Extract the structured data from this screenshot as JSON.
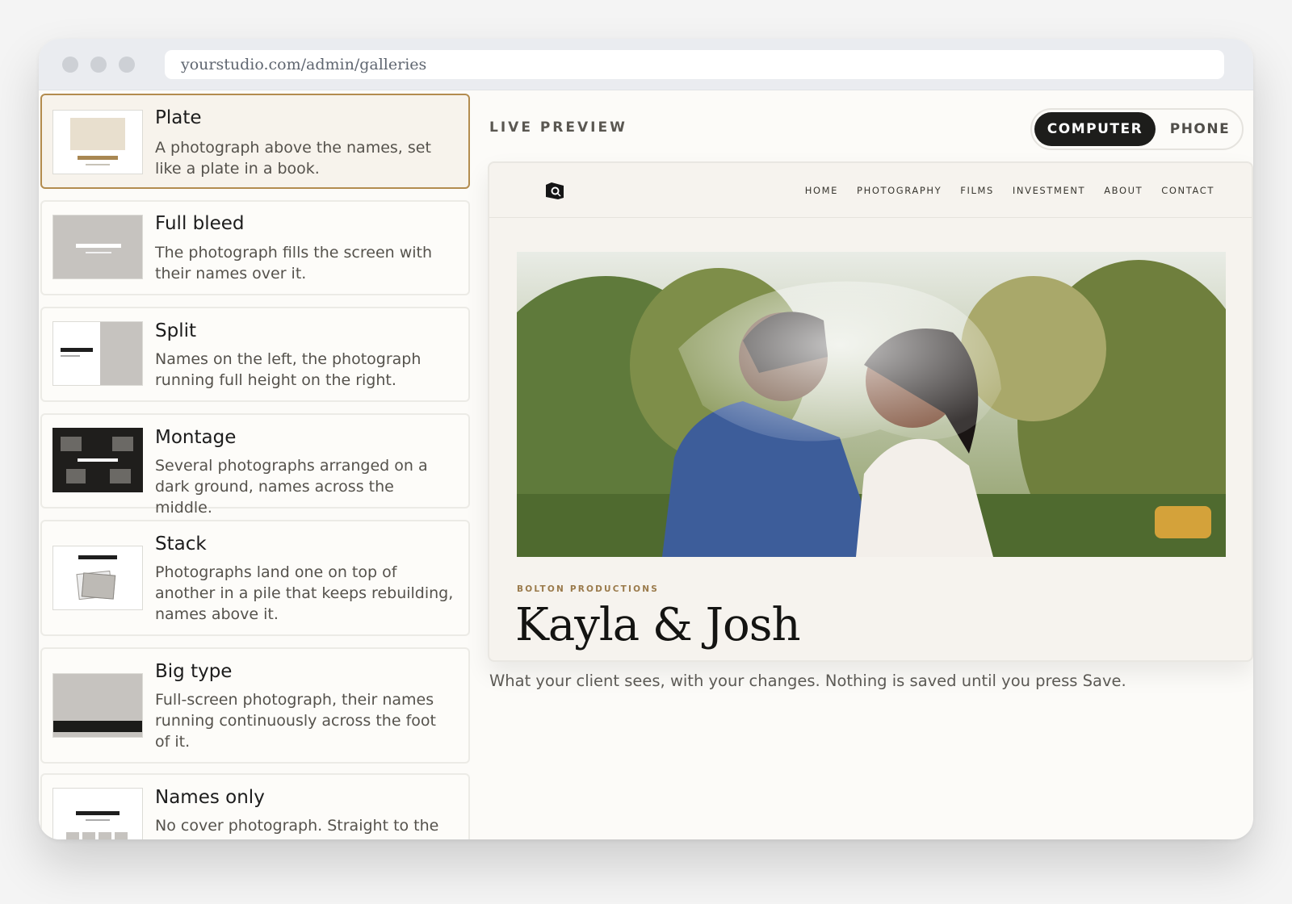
{
  "browser": {
    "url": "yourstudio.com/admin/galleries"
  },
  "layouts": [
    {
      "title": "Plate",
      "description": "A photograph above the names, set like a plate in a book.",
      "selected": true
    },
    {
      "title": "Full bleed",
      "description": "The photograph fills the screen with their names over it.",
      "selected": false
    },
    {
      "title": "Split",
      "description": "Names on the left, the photograph running full height on the right.",
      "selected": false
    },
    {
      "title": "Montage",
      "description": "Several photographs arranged on a dark ground, names across the middle.",
      "selected": false
    },
    {
      "title": "Stack",
      "description": "Photographs land one on top of another in a pile that keeps rebuilding, names above it.",
      "selected": false
    },
    {
      "title": "Big type",
      "description": "Full-screen photograph, their names running continuously across the foot of it.",
      "selected": false
    },
    {
      "title": "Names only",
      "description": "No cover photograph. Straight to the",
      "selected": false
    }
  ],
  "preview": {
    "label": "LIVE PREVIEW",
    "toggle": {
      "computer": "COMPUTER",
      "phone": "PHONE",
      "active": "computer"
    },
    "site": {
      "nav": [
        "HOME",
        "PHOTOGRAPHY",
        "FILMS",
        "INVESTMENT",
        "ABOUT",
        "CONTACT"
      ],
      "studio": "BOLTON PRODUCTIONS",
      "couple": "Kayla & Josh"
    },
    "caption": "What your client sees, with your changes. Nothing is saved until you press Save."
  },
  "colors": {
    "accent": "#b38c4f",
    "dark": "#1d1d1b",
    "background": "#fcfbf8"
  }
}
